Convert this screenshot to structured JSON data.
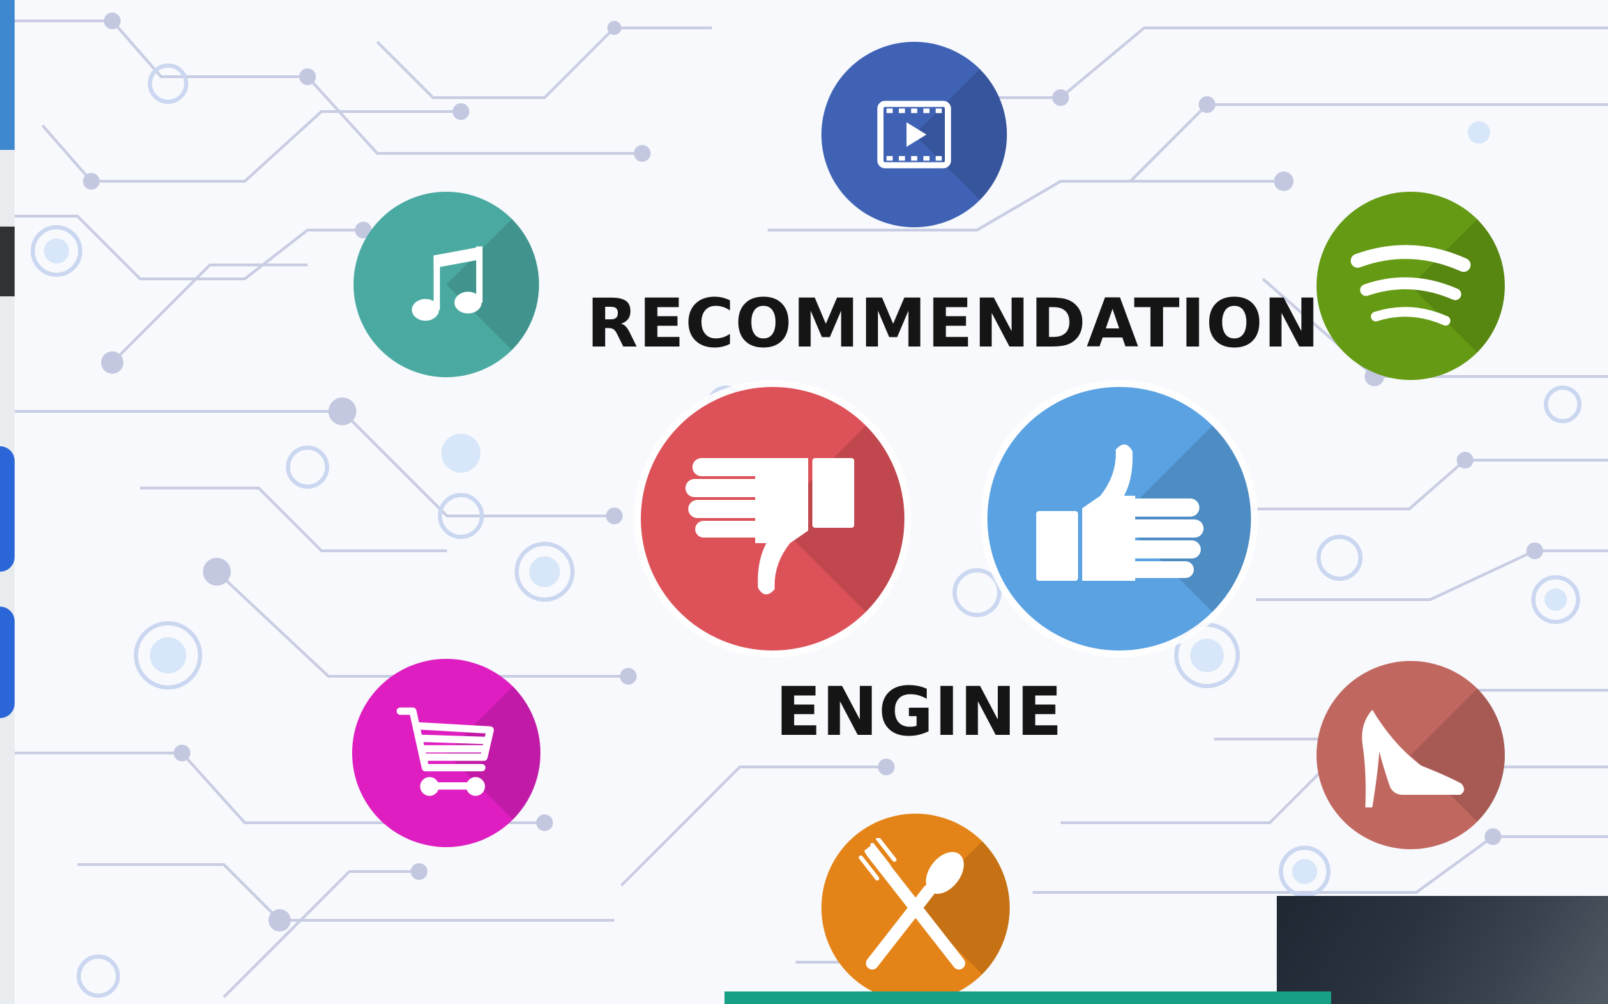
{
  "title_line1": "RECOMMENDATION",
  "title_line2": "ENGINE",
  "icons": [
    {
      "name": "video",
      "color": "#3f62b5"
    },
    {
      "name": "music",
      "color": "#4aaaa2"
    },
    {
      "name": "spotify",
      "color": "#659a14"
    },
    {
      "name": "thumbs-down",
      "color": "#dd5259"
    },
    {
      "name": "thumbs-up",
      "color": "#5aa2e2"
    },
    {
      "name": "shopping-cart",
      "color": "#de1ec0"
    },
    {
      "name": "high-heel",
      "color": "#c06860"
    },
    {
      "name": "fork-and-spoon",
      "color": "#e48418"
    }
  ]
}
